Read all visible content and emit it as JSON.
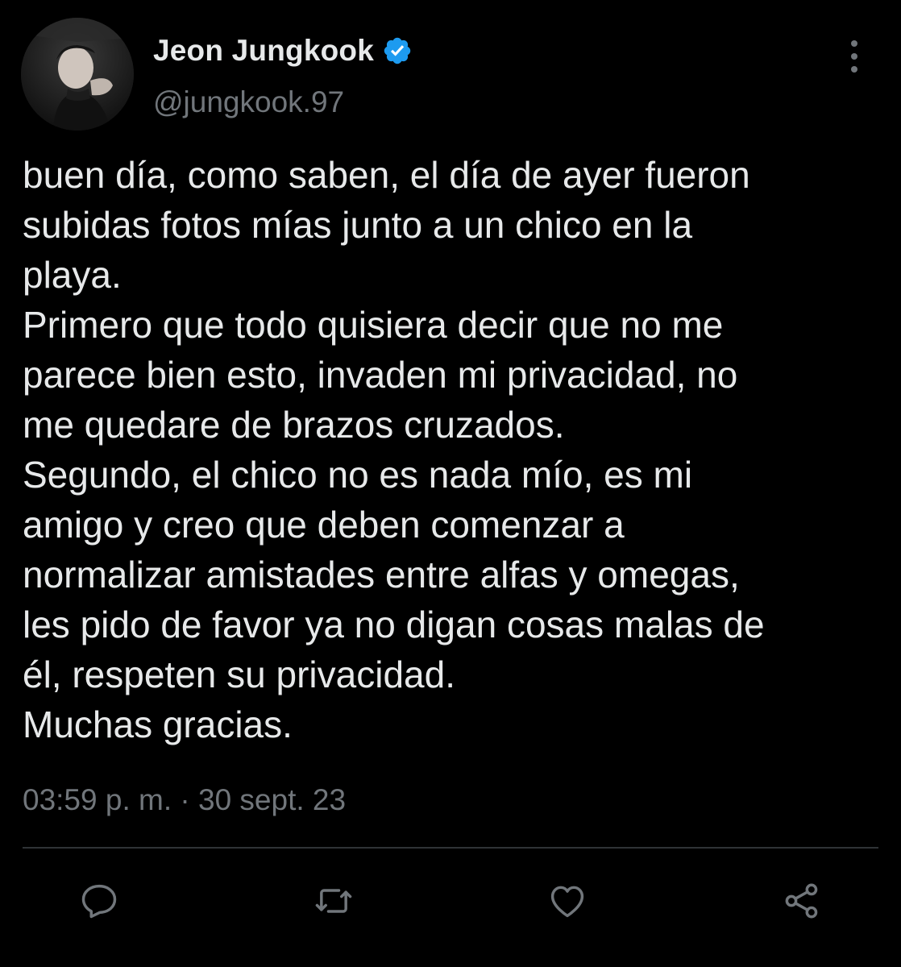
{
  "author": {
    "display_name": "Jeon Jungkook",
    "handle": "@jungkook.97",
    "verified": true,
    "verified_color": "#1d9bf0"
  },
  "tweet": {
    "lines": [
      "buen día, como saben, el día de ayer fueron",
      "subidas fotos mías junto a un chico en la",
      "playa.",
      "Primero que todo quisiera decir que no me",
      "parece bien esto, invaden mi privacidad, no",
      "me quedare de brazos cruzados.",
      "Segundo, el chico no es nada mío, es mi",
      "amigo y creo que deben comenzar a",
      "normalizar amistades entre alfas y omegas,",
      "les pido de favor ya no digan cosas malas de",
      "él, respeten su privacidad.",
      "Muchas gracias."
    ],
    "time": "03:59 p. m.",
    "separator": "·",
    "date": "30 sept. 23"
  },
  "actions": {
    "reply_icon": "reply-icon",
    "retweet_icon": "retweet-icon",
    "like_icon": "heart-icon",
    "share_icon": "share-icon"
  },
  "colors": {
    "background": "#000000",
    "text": "#e7e9ea",
    "muted": "#71767b",
    "divider": "#2f3336"
  }
}
